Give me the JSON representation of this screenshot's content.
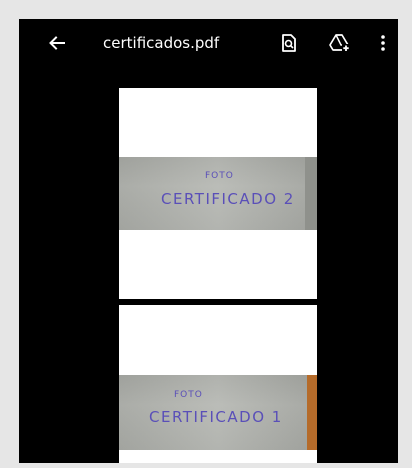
{
  "toolbar": {
    "title": "certificados.pdf",
    "back_icon": "arrow-left-icon",
    "search_icon": "find-in-page-icon",
    "drive_icon": "add-to-drive-icon",
    "more_icon": "more-vertical-icon"
  },
  "pages": [
    {
      "photo_caption": "FOTO",
      "photo_text": "CERTIFICADO 2"
    },
    {
      "photo_caption": "FOTO",
      "photo_text": "CERTIFICADO 1"
    }
  ],
  "colors": {
    "background": "#000000",
    "toolbar_text": "#ffffff",
    "ink": "#5a4fb8",
    "outer_border": "#e6e6e6"
  }
}
